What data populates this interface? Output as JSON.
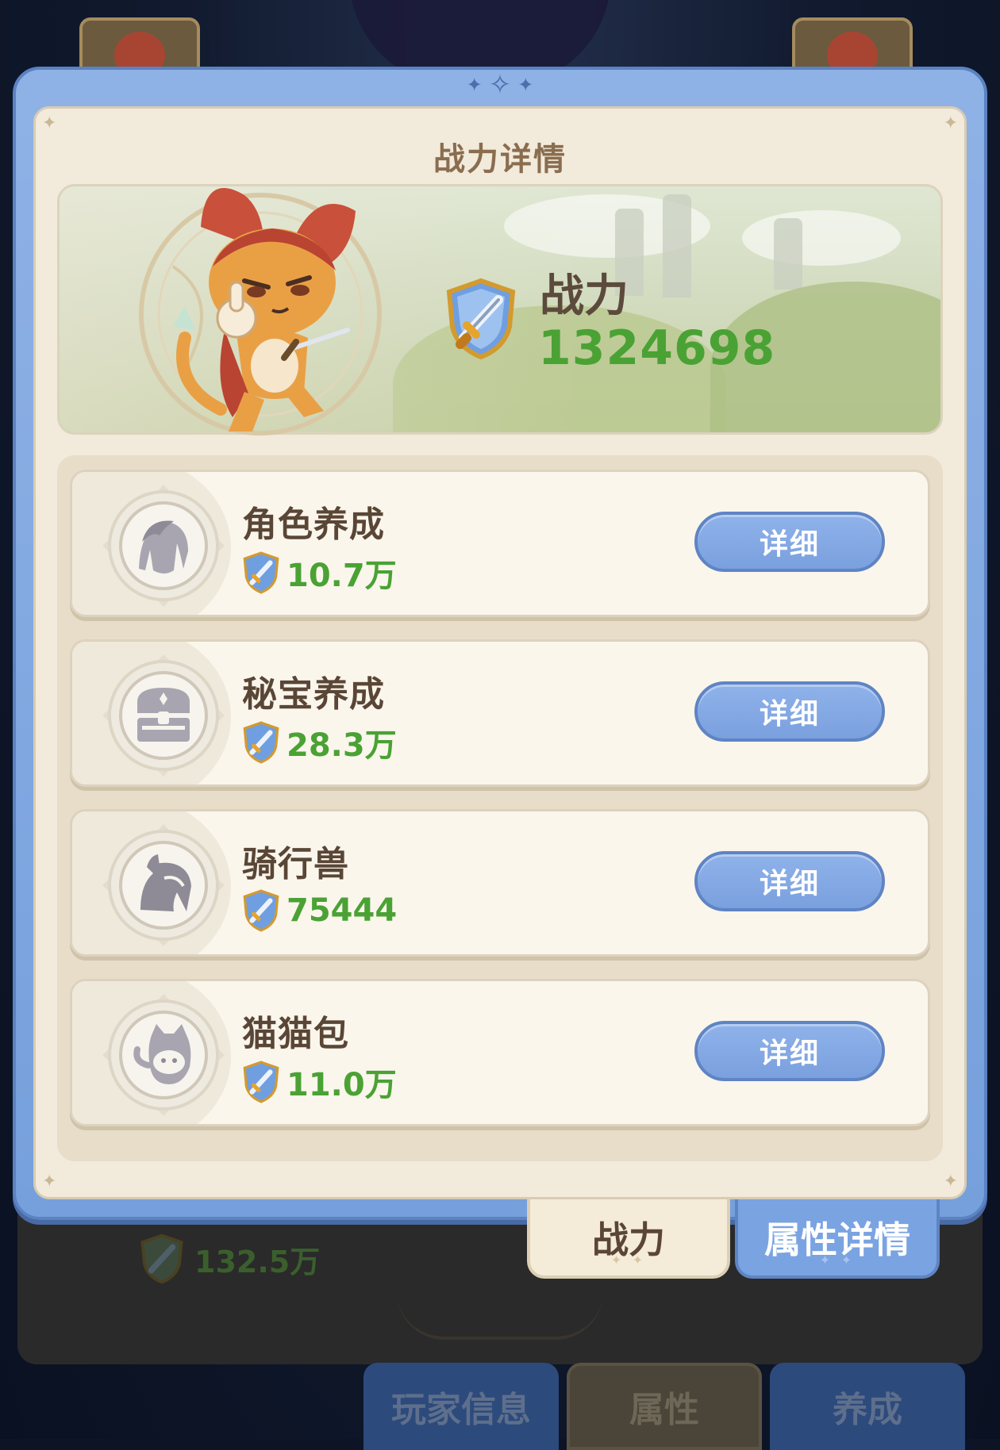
{
  "dialog": {
    "title": "战力详情",
    "total_power_label": "战力",
    "total_power_value": "1324698"
  },
  "categories": [
    {
      "name": "角色养成",
      "power": "10.7万",
      "button_label": "详细",
      "icon": "character-silhouette-icon"
    },
    {
      "name": "秘宝养成",
      "power": "28.3万",
      "button_label": "详细",
      "icon": "treasure-chest-icon"
    },
    {
      "name": "骑行兽",
      "power": "75444",
      "button_label": "详细",
      "icon": "horse-head-icon"
    },
    {
      "name": "猫猫包",
      "power": "11.0万",
      "button_label": "详细",
      "icon": "cat-bag-icon"
    }
  ],
  "dialog_tabs": [
    {
      "label": "战力",
      "active": true
    },
    {
      "label": "属性详情",
      "active": false
    }
  ],
  "background": {
    "power_value": "132.5万",
    "bottom_tabs": [
      "玩家信息",
      "属性",
      "养成"
    ]
  },
  "colors": {
    "frame_blue": "#7aa3e2",
    "panel_cream": "#f2eadb",
    "power_green": "#4aa234",
    "text_brown": "#5a4636"
  }
}
